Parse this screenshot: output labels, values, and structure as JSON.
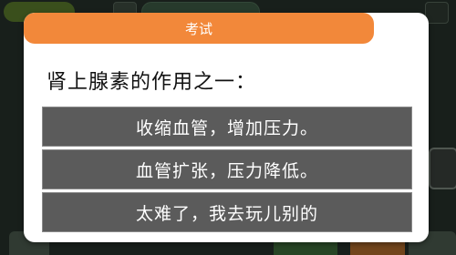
{
  "dialog": {
    "title": "考试",
    "question": "肾上腺素的作用之一：",
    "options": [
      "收缩血管，增加压力。",
      "血管扩张，压力降低。",
      "太难了，我去玩儿别的"
    ]
  },
  "colors": {
    "header": "#f2883a",
    "option_bg": "#5b5b5b",
    "dialog_bg": "#ffffff"
  }
}
